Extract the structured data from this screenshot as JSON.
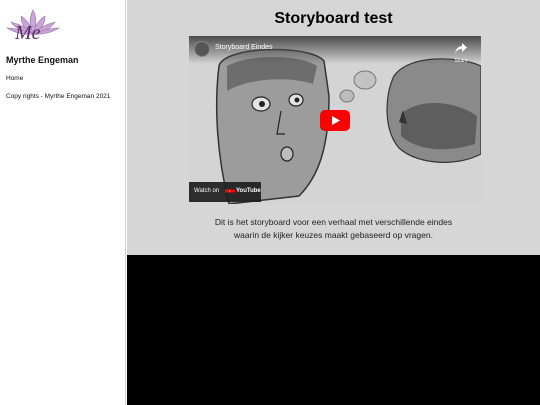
{
  "sidebar": {
    "logo_text": "Me",
    "site_name": "Myrthe Engeman",
    "nav": [
      {
        "label": "Home"
      }
    ],
    "copyright": "Copy rights - Myrthe Engeman 2021"
  },
  "main": {
    "title": "Storyboard test",
    "video": {
      "title": "Storyboard Eindes",
      "share_label": "Share",
      "watch_on_label": "Watch on",
      "youtube_label": "YouTube"
    },
    "description_line1": "Dit is het storyboard voor een verhaal met verschillende eindes",
    "description_line2": "waarin de kijker keuzes maakt gebaseerd op vragen."
  },
  "colors": {
    "youtube_red": "#ff0000",
    "logo_purple": "#8a4e9b",
    "content_bg": "#d6d6d6"
  }
}
